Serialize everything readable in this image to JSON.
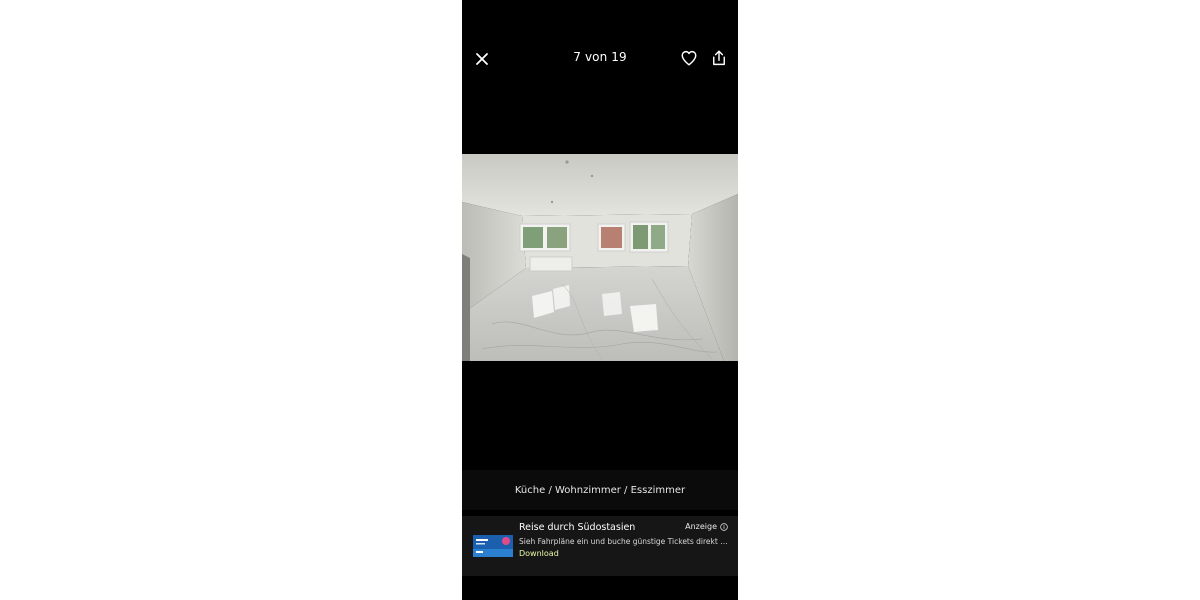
{
  "gallery": {
    "counter": "7 von 19",
    "caption": "Küche / Wohnzimmer / Esszimmer"
  },
  "icons": {
    "close": "close-icon",
    "favorite": "heart-icon",
    "share": "share-icon",
    "info": "info-icon"
  },
  "ad": {
    "title": "Reise durch Südostasien",
    "label": "Anzeige",
    "text": "Sieh Fahrpläne ein und buche günstige Tickets direkt a...",
    "cta": "Download"
  },
  "colors": {
    "background": "#000000",
    "cta": "#e9f9a6"
  }
}
